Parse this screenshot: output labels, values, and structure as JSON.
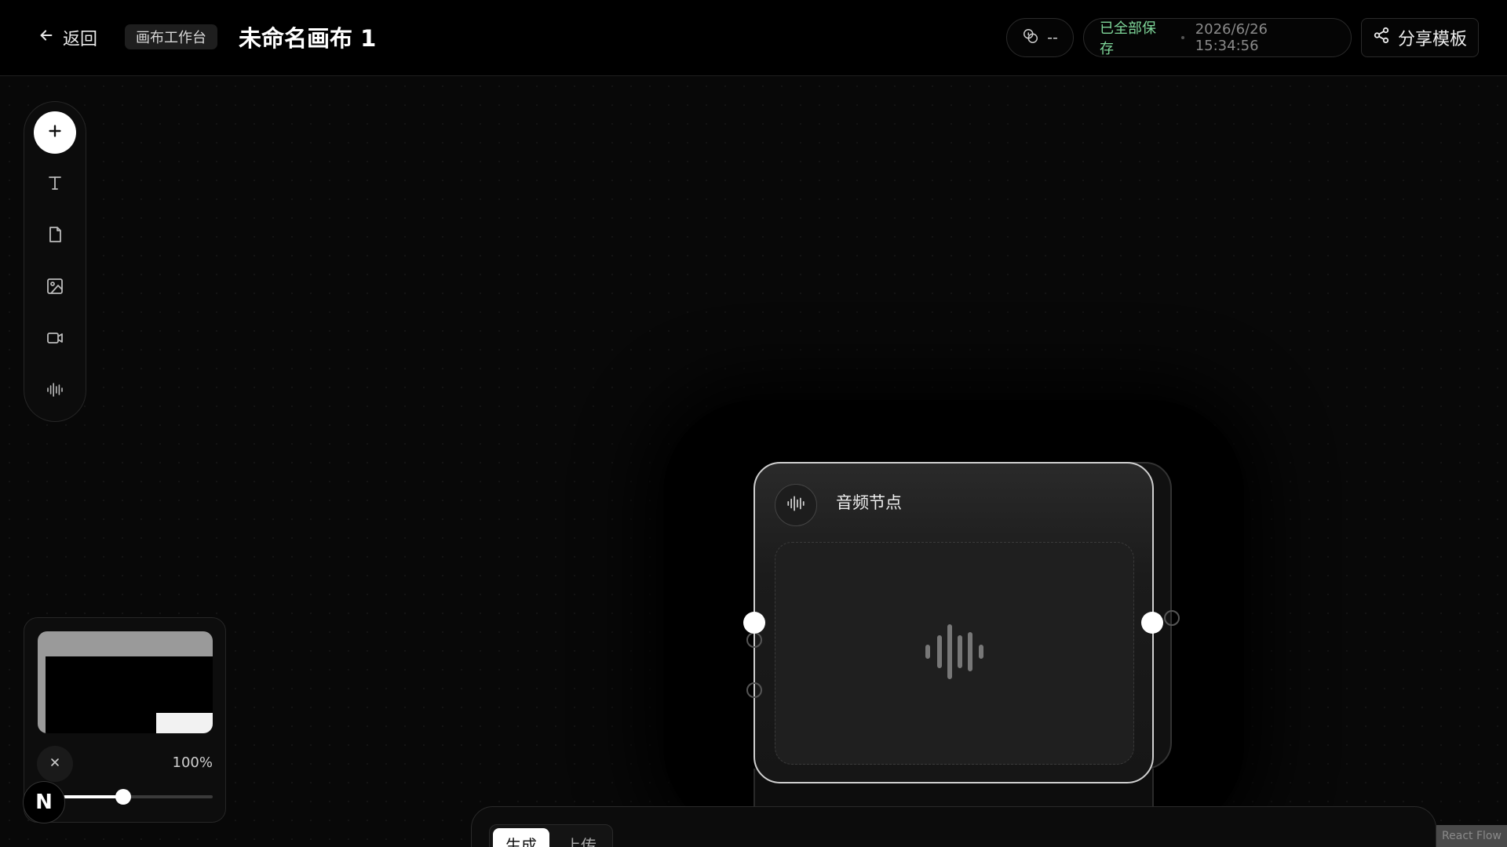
{
  "header": {
    "back_label": "返回",
    "breadcrumb": "画布工作台",
    "title": "未命名画布 1",
    "credits_value": "--",
    "save_status": "已全部保存",
    "save_time": "2026/6/26 15:34:56",
    "share_label": "分享模板"
  },
  "toolbar": {
    "items": [
      "add-icon",
      "text-icon",
      "document-icon",
      "image-icon",
      "video-icon",
      "audio-wave-icon"
    ]
  },
  "minimap": {
    "zoom_label": "100%",
    "zoom_level": 0.4
  },
  "n_badge": "N",
  "node": {
    "title": "音频节点",
    "icon": "audio-wave-icon"
  },
  "prompt": {
    "tabs": [
      "生成",
      "上传"
    ],
    "active_tab": 0
  },
  "attribution": "React Flow",
  "colors": {
    "save_status": "#7fd79a",
    "accent": "#ffffff",
    "background": "#0a0a0a"
  }
}
